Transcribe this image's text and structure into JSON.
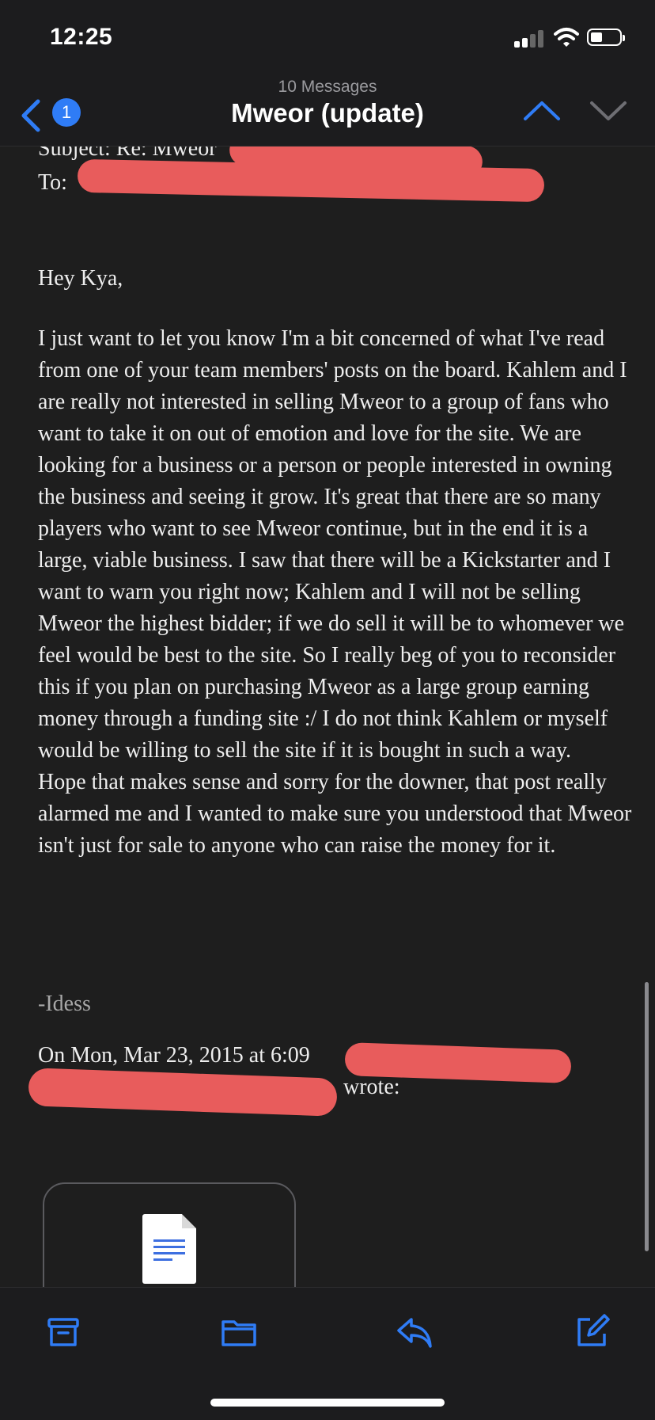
{
  "status_bar": {
    "time": "12:25"
  },
  "nav": {
    "back_badge": "1",
    "message_count": "10 Messages",
    "title": "Mweor (update)",
    "icons": {
      "back": "chevron-left-icon",
      "previous": "chevron-up-icon",
      "next": "chevron-down-icon"
    }
  },
  "email": {
    "subject_line": "Subject: Re: Mweor",
    "to_label": "To:",
    "greeting": "Hey Kya,",
    "body_paragraphs": [
      "I just want to let you know I'm a bit concerned of what I've read from one of your team members' posts on the board. Kahlem and I are really not interested in selling Mweor to a group of fans who want to take it on out of emotion and love for the site. We are looking for a business or a person or people interested in owning the business and seeing it grow. It's great that there are so many players who want to see Mweor continue, but in the end it is a large, viable business. I saw that there will be a Kickstarter and I want to warn you right now; Kahlem and I will not be selling Mweor the highest bidder; if we do sell it will be to whomever we feel would be best to the site. So I really beg of you to reconsider this if you plan on purchasing Mweor as a large group earning money through a funding site :/ I do not think Kahlem or myself would be willing to sell the site if it is bought in such a way.",
      "Hope that makes sense and sorry for the downer, that post really alarmed me and I wanted to make sure you understood that Mweor isn't just for sale to anyone who can raise the money for it."
    ],
    "signature": "-Idess",
    "quote_header": "On Mon, Mar 23, 2015 at 6:09",
    "quote_wrote": "wrote:",
    "attachment_icon": "document-icon"
  },
  "toolbar": {
    "icons": [
      "archive-icon",
      "folder-icon",
      "reply-icon",
      "compose-icon"
    ]
  },
  "colors": {
    "background": "#1e1e1e",
    "accent": "#2f7cf6",
    "redaction": "#e85c5c"
  }
}
